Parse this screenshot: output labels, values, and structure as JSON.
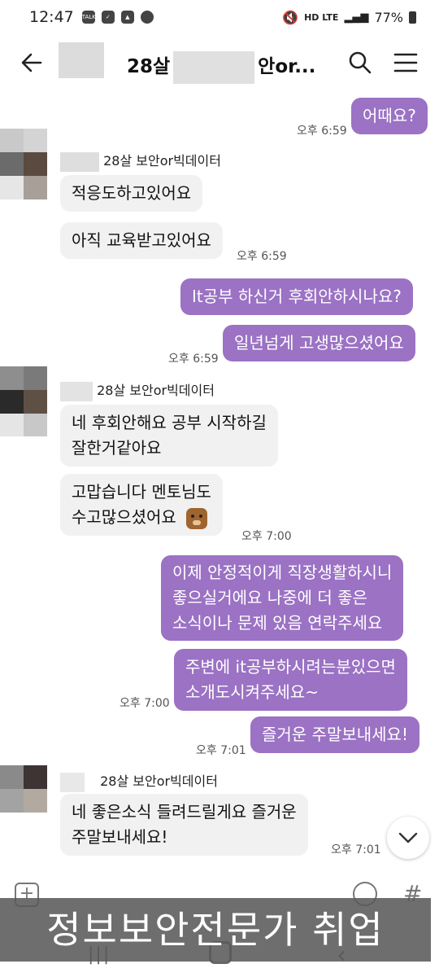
{
  "status": {
    "time": "12:47",
    "left_icons": [
      "talk-icon",
      "check-icon",
      "image-icon",
      "chat-bubble-icon"
    ],
    "signal_text": "HD LTE",
    "battery": "77%"
  },
  "header": {
    "title_part1": "28살",
    "title_part2": "안or...",
    "back_icon": "arrow-left-icon",
    "search_icon": "search-icon",
    "menu_icon": "hamburger-icon"
  },
  "chat": {
    "m1": {
      "text": "어때요?",
      "time": "오후 6:59"
    },
    "sender1": "28살 보안or빅데이터",
    "r1": {
      "text": "적응도하고있어요"
    },
    "r2": {
      "text": "아직 교육받고있어요",
      "time": "오후 6:59"
    },
    "m2": {
      "text": "It공부 하신거 후회안하시나요?"
    },
    "m3": {
      "text": "일년넘게 고생많으셨어요",
      "time": "오후 6:59"
    },
    "sender2": "28살 보안or빅데이터",
    "r3": {
      "line1": "네 후회안해요 공부 시작하길",
      "line2": "잘한거같아요"
    },
    "r4": {
      "line1": "고맙습니다 멘토님도",
      "line2": "수고많으셨어요",
      "time": "오후 7:00"
    },
    "m4": {
      "line1": "이제 안정적이게  직장생활하시니",
      "line2": "좋으실거에요 나중에 더  좋은",
      "line3": "소식이나  문제 있음  연락주세요"
    },
    "m5": {
      "line1": "주변에 it공부하시려는분있으면",
      "line2": "소개도시켜주세요~",
      "time": "오후 7:00"
    },
    "m6": {
      "text": "즐거운 주말보내세요!",
      "time": "오후 7:01"
    },
    "sender3": "28살 보안or빅데이터",
    "r5": {
      "line1": "네 좋은소식 들려드릴게요 즐거운",
      "line2": "주말보내세요!",
      "time": "오후 7:01"
    }
  },
  "input": {
    "plus_icon": "plus-icon",
    "emoji_icon": "emoji-icon",
    "hash_label": "#"
  },
  "caption": "정보보안전문가 취업",
  "colors": {
    "my_bubble": "#9b72c4",
    "other_bubble": "#f1f1f1"
  }
}
